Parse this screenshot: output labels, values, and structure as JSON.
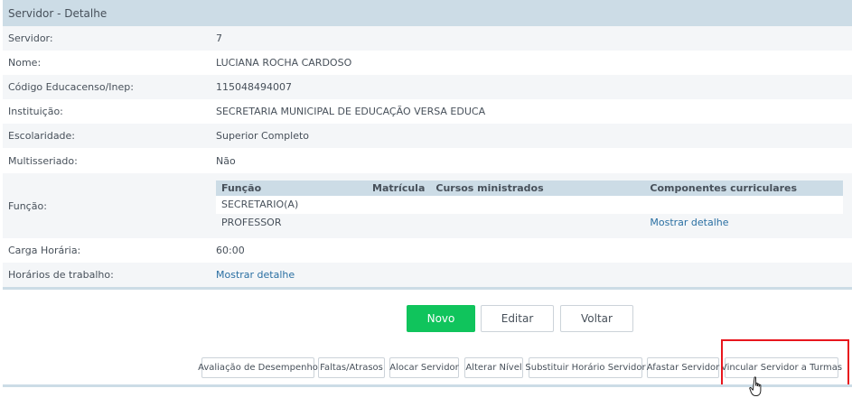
{
  "header": {
    "title": "Servidor - Detalhe"
  },
  "fields": {
    "servidor": {
      "label": "Servidor:",
      "value": "7"
    },
    "nome": {
      "label": "Nome:",
      "value": "LUCIANA ROCHA CARDOSO"
    },
    "codigo": {
      "label": "Código Educacenso/Inep:",
      "value": "115048494007"
    },
    "instituicao": {
      "label": "Instituição:",
      "value": "SECRETARIA MUNICIPAL DE EDUCAÇÃO VERSA EDUCA"
    },
    "escolaridade": {
      "label": "Escolaridade:",
      "value": "Superior Completo"
    },
    "multisseriado": {
      "label": "Multisseriado:",
      "value": "Não"
    },
    "funcao": {
      "label": "Função:"
    },
    "carga": {
      "label": "Carga Horária:",
      "value": "60:00"
    },
    "horarios": {
      "label": "Horários de trabalho:",
      "value": "Mostrar detalhe"
    }
  },
  "funcao_table": {
    "headers": [
      "Função",
      "Matrícula",
      "Cursos ministrados",
      "Componentes curriculares"
    ],
    "rows": [
      [
        "SECRETARIO(A)",
        "",
        "",
        ""
      ],
      [
        "PROFESSOR",
        "",
        "",
        "Mostrar detalhe"
      ]
    ]
  },
  "actions": {
    "novo": "Novo",
    "editar": "Editar",
    "voltar": "Voltar"
  },
  "secondary_actions": {
    "avaliacao": "Avaliação de Desempenho",
    "faltas": "Faltas/Atrasos",
    "alocar": "Alocar Servidor",
    "alterar": "Alterar Nível",
    "substituir": "Substituir Horário Servidor",
    "afastar": "Afastar Servidor",
    "vincular": "Vincular Servidor a Turmas"
  },
  "colors": {
    "header_bg": "#ccdce6",
    "primary_button": "#10c45c",
    "link": "#2a6fa2",
    "highlight": "#e8161d"
  },
  "icons": {
    "cursor": "hand-pointer-icon"
  }
}
